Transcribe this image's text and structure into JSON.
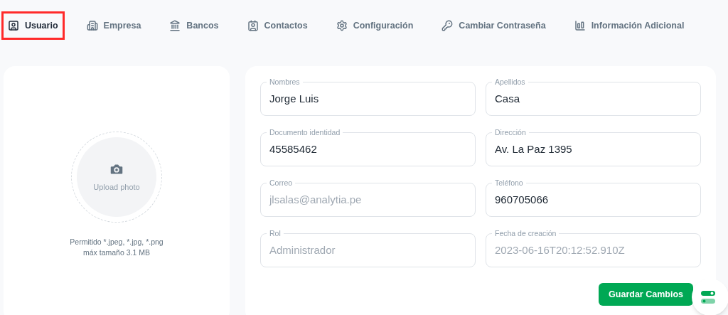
{
  "tabs": [
    {
      "label": "Usuario",
      "selected": true
    },
    {
      "label": "Empresa",
      "selected": false
    },
    {
      "label": "Bancos",
      "selected": false
    },
    {
      "label": "Contactos",
      "selected": false
    },
    {
      "label": "Configuración",
      "selected": false
    },
    {
      "label": "Cambiar Contraseña",
      "selected": false
    },
    {
      "label": "Información Adicional",
      "selected": false
    }
  ],
  "photo": {
    "label": "Upload photo",
    "hint_lines": [
      "Permitido *.jpeg, *.jpg, *.png",
      "máx tamaño 3.1 MB"
    ]
  },
  "fields": [
    {
      "label": "Nombres",
      "value": "Jorge Luis",
      "disabled": false
    },
    {
      "label": "Apellidos",
      "value": "Casa",
      "disabled": false
    },
    {
      "label": "Documento identidad",
      "value": "45585462",
      "disabled": false
    },
    {
      "label": "Dirección",
      "value": "Av. La Paz 1395",
      "disabled": false
    },
    {
      "label": "Correo",
      "value": "jlsalas@analytia.pe",
      "disabled": true
    },
    {
      "label": "Teléfono",
      "value": "960705066",
      "disabled": false
    },
    {
      "label": "Rol",
      "value": "Administrador",
      "disabled": true
    },
    {
      "label": "Fecha de creación",
      "value": "2023-06-16T20:12:52.910Z",
      "disabled": true
    }
  ],
  "save_button": "Guardar Cambios"
}
